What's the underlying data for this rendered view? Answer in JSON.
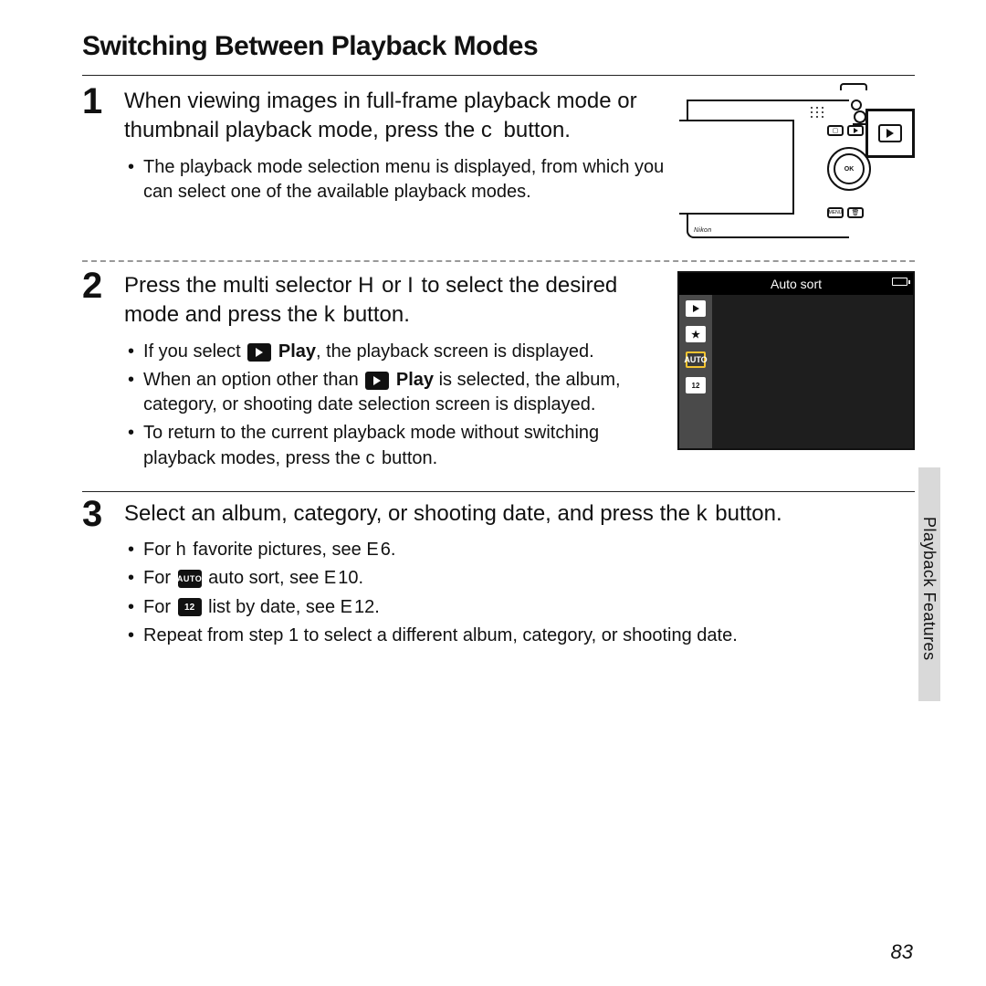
{
  "title": "Switching Between Playback Modes",
  "side_label": "Playback Features",
  "page_number": "83",
  "step1": {
    "num": "1",
    "head_a": "When viewing images in full-frame playback mode or thumbnail playback mode, press the ",
    "head_b": "c",
    "head_c": " button.",
    "bullet1": "The playback mode selection menu is displayed, from which you can select one of the available playback modes.",
    "camera_brand": "Nikon",
    "ok": "OK",
    "menu_label": "MENU"
  },
  "step2": {
    "num": "2",
    "head_a": "Press the multi selector ",
    "head_b": "H",
    "head_c": " or ",
    "head_d": "I",
    "head_e": " to select the desired mode and press the ",
    "head_f": "k",
    "head_g": " button.",
    "b1a": "If you select ",
    "b1b": "Play",
    "b1c": ", the playback screen is displayed.",
    "b2a": "When an option other than ",
    "b2b": "Play",
    "b2c": " is selected, the album, category, or shooting date selection screen is displayed.",
    "b3a": "To return to the current playback mode without switching playback modes, press the ",
    "b3b": "c",
    "b3c": " button.",
    "lcd_title": "Auto sort",
    "lcd_auto": "AUTO",
    "lcd_cal": "12"
  },
  "step3": {
    "num": "3",
    "head_a": "Select an album, category, or shooting date, and press the ",
    "head_b": "k",
    "head_c": " button.",
    "b1a": "For ",
    "b1b": "h",
    "b1c": " favorite pictures, see ",
    "b1d": "E",
    "b1e": "6.",
    "b2a": "For ",
    "b2b": "AUTO",
    "b2c": " auto sort, see ",
    "b2d": "E",
    "b2e": "10.",
    "b3a": "For ",
    "b3b": "12",
    "b3c": " list by date, see ",
    "b3d": "E",
    "b3e": "12.",
    "b4": "Repeat from step 1 to select a different album, category, or shooting date."
  }
}
